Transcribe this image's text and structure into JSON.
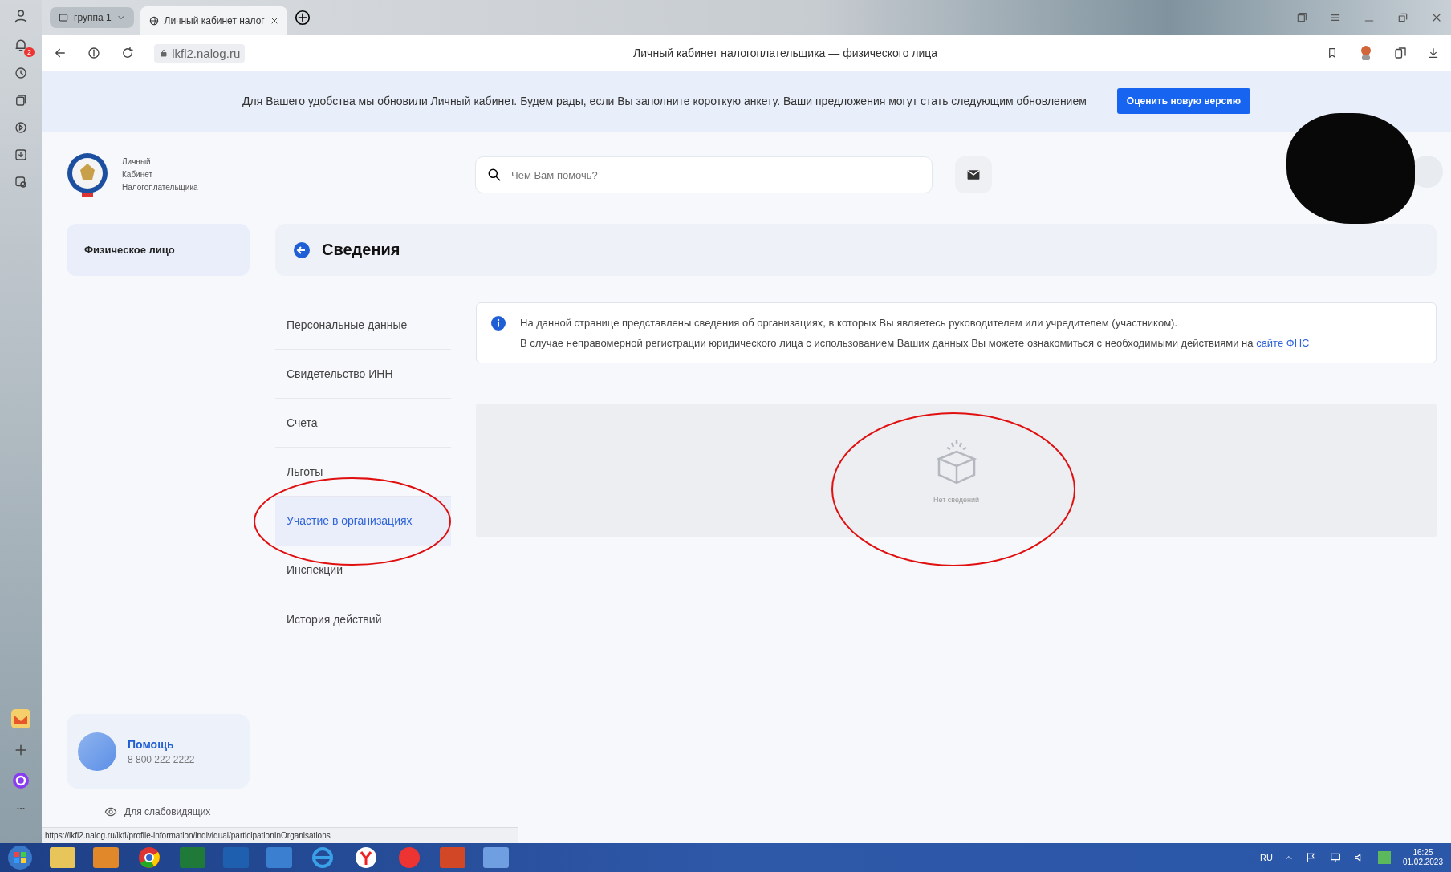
{
  "browser": {
    "tabs": [
      {
        "label": "группа 1",
        "selected": false
      },
      {
        "label": "Личный кабинет налог",
        "selected": true
      }
    ],
    "address": "lkfl2.nalog.ru",
    "page_title": "Личный кабинет налогоплательщика — физического лица",
    "notification_count": "2"
  },
  "banner": {
    "text": "Для Вашего удобства мы обновили Личный кабинет. Будем рады, если Вы заполните короткую анкету. Ваши предложения могут стать следующим обновлением",
    "button": "Оценить новую версию"
  },
  "header": {
    "logo_lines": [
      "Личный",
      "Кабинет",
      "Налогоплательщика"
    ],
    "search": {
      "placeholder": "Чем Вам помочь?"
    }
  },
  "sidebar": {
    "section": "Физическое лицо",
    "help": {
      "title": "Помощь",
      "phone": "8 800 222 2222"
    },
    "accessibility": "Для слабовидящих"
  },
  "page": {
    "title": "Сведения",
    "menu": [
      {
        "label": "Персональные данные",
        "selected": false
      },
      {
        "label": "Свидетельство ИНН",
        "selected": false
      },
      {
        "label": "Счета",
        "selected": false
      },
      {
        "label": "Льготы",
        "selected": false
      },
      {
        "label": "Участие в организациях",
        "selected": true
      },
      {
        "label": "Инспекции",
        "selected": false
      },
      {
        "label": "История действий",
        "selected": false
      }
    ],
    "info": {
      "line_1": "На данной странице представлены сведения об организациях, в которых Вы являетесь руководителем или учредителем (участником).",
      "line_2": "В случае неправомерной регистрации юридического лица с использованием Ваших данных Вы можете ознакомиться с необходимыми действиями на",
      "link": "сайте ФНС"
    },
    "empty_state": "Нет сведений"
  },
  "status_url": "https://lkfl2.nalog.ru/lkfl/profile-information/individual/participationInOrganisations",
  "taskbar": {
    "language": "RU",
    "time": "16:25",
    "date": "01.02.2023"
  }
}
